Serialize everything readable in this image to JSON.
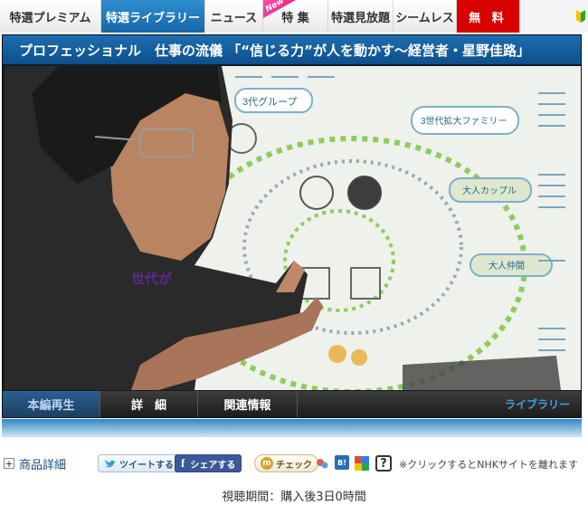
{
  "nav": {
    "tabs": [
      {
        "label": "特選プレミアム"
      },
      {
        "label": "特選ライブラリー"
      },
      {
        "label": "ニュース"
      },
      {
        "label": "特 集",
        "badge": "New"
      },
      {
        "label": "特選見放題"
      },
      {
        "label": "シームレス"
      },
      {
        "label": "無 料"
      }
    ]
  },
  "player": {
    "title": "プロフェッショナル　仕事の流儀 「“信じる力”が人を動かす〜経営者・星野佳路」",
    "controls": {
      "tabs": [
        "本編再生",
        "詳　細",
        "関連情報"
      ],
      "library_link": "ライブラリー"
    },
    "board_text": {
      "group": "3代グループ",
      "family": "3世代拡大ファミリー",
      "adult_couple": "大人カップル",
      "adult_friends": "大人仲間",
      "generation": "世代が"
    }
  },
  "social": {
    "detail_label": "商品詳細",
    "tweet_label": "ツイートする",
    "share_label": "シェアする",
    "mixi_label": "チェック",
    "hatena_label": "B!",
    "help_label": "?",
    "notice": "※クリックするとNHKサイトを離れます"
  },
  "viewing_period": "視聴期間：購入後3日0時間",
  "colors": {
    "accent_blue": "#1766a8",
    "free_red": "#d90000",
    "facebook": "#3b5998",
    "board_green": "#7bbf4a"
  }
}
